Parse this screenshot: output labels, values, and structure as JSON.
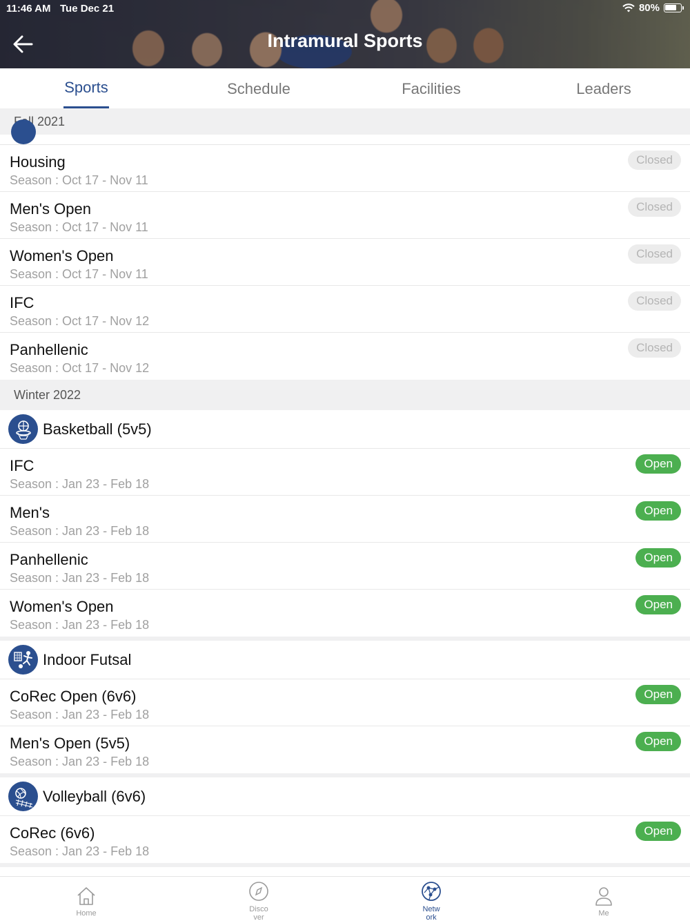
{
  "status_bar": {
    "time": "11:46 AM",
    "date": "Tue Dec 21",
    "battery": "80%",
    "battery_level": 0.8
  },
  "header": {
    "title": "Intramural Sports"
  },
  "tabs": [
    {
      "label": "Sports",
      "active": true
    },
    {
      "label": "Schedule"
    },
    {
      "label": "Facilities"
    },
    {
      "label": "Leaders"
    }
  ],
  "sections": [
    {
      "title": "Fall 2021",
      "rows": [
        {
          "name": "Housing",
          "season": "Season : Oct 17 - Nov 11",
          "status": "Closed"
        },
        {
          "name": "Men's Open",
          "season": "Season : Oct 17 - Nov 11",
          "status": "Closed"
        },
        {
          "name": "Women's Open",
          "season": "Season : Oct 17 - Nov 11",
          "status": "Closed"
        },
        {
          "name": "IFC",
          "season": "Season : Oct 17 - Nov 12",
          "status": "Closed"
        },
        {
          "name": "Panhellenic",
          "season": "Season : Oct 17 - Nov 12",
          "status": "Closed"
        }
      ]
    },
    {
      "title": "Winter 2022",
      "sports": [
        {
          "name": "Basketball (5v5)",
          "icon": "basketball-icon",
          "rows": [
            {
              "name": "IFC",
              "season": "Season : Jan 23 - Feb 18",
              "status": "Open"
            },
            {
              "name": "Men's",
              "season": "Season : Jan 23 - Feb 18",
              "status": "Open"
            },
            {
              "name": "Panhellenic",
              "season": "Season : Jan 23 - Feb 18",
              "status": "Open"
            },
            {
              "name": "Women's Open",
              "season": "Season : Jan 23 - Feb 18",
              "status": "Open"
            }
          ]
        },
        {
          "name": "Indoor Futsal",
          "icon": "futsal-icon",
          "rows": [
            {
              "name": "CoRec Open (6v6)",
              "season": "Season : Jan 23 - Feb 18",
              "status": "Open"
            },
            {
              "name": "Men's Open (5v5)",
              "season": "Season : Jan 23 - Feb 18",
              "status": "Open"
            }
          ]
        },
        {
          "name": "Volleyball (6v6)",
          "icon": "volleyball-icon",
          "rows": [
            {
              "name": "CoRec (6v6)",
              "season": "Season : Jan 23 - Feb 18",
              "status": "Open"
            }
          ]
        }
      ]
    }
  ],
  "bottom_nav": [
    {
      "label": "Home",
      "icon": "home-icon"
    },
    {
      "label": "Disco\nver",
      "icon": "compass-icon"
    },
    {
      "label": "Netw\nork",
      "icon": "network-icon",
      "active": true
    },
    {
      "label": "Me",
      "icon": "person-icon"
    }
  ],
  "colors": {
    "accent": "#2b4f8f",
    "open_green": "#4caf50",
    "closed_gray": "#ececec",
    "section_bg": "#f0f0f1"
  }
}
